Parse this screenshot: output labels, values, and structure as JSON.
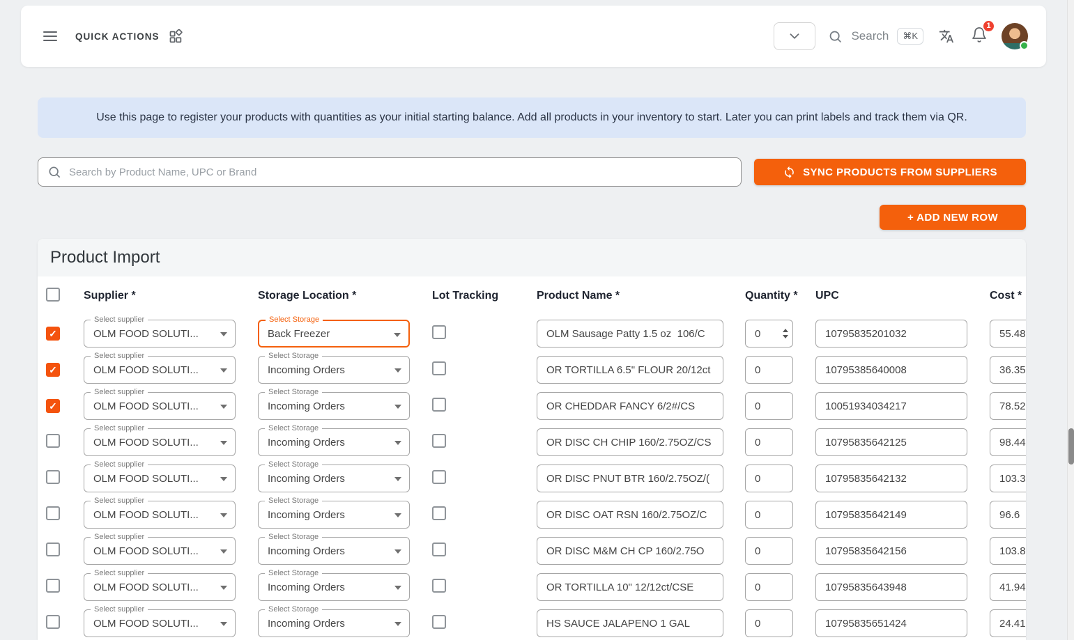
{
  "colors": {
    "accent": "#f4600c",
    "checkbox": "#f4530e",
    "banner_bg": "#dbe6f8",
    "badge_red": "#ef4130",
    "status_green": "#36b24a"
  },
  "topbar": {
    "quick_actions": "QUICK ACTIONS",
    "search_label": "Search",
    "search_shortcut": "⌘K",
    "notification_badge": "1"
  },
  "banner_text": "Use this page to register your products with quantities as your initial starting balance. Add all products in your inventory to start. Later you can print labels and track them via QR.",
  "search_placeholder": "Search by Product Name, UPC or Brand",
  "sync_button": "SYNC PRODUCTS FROM SUPPLIERS",
  "add_row_button": "+ ADD NEW ROW",
  "section_title": "Product Import",
  "table": {
    "headers": {
      "supplier": "Supplier *",
      "storage": "Storage Location *",
      "lot": "Lot Tracking",
      "product": "Product Name *",
      "quantity": "Quantity *",
      "upc": "UPC",
      "cost": "Cost *"
    },
    "supplier_label": "Select supplier",
    "storage_label": "Select Storage",
    "rows": [
      {
        "checked": true,
        "supplier": "OLM FOOD SOLUTI...",
        "storage": "Back Freezer",
        "storage_focused": true,
        "lot": false,
        "product": "OLM Sausage Patty 1.5 oz  106/C",
        "quantity": "0",
        "stepper": true,
        "upc": "10795835201032",
        "cost": "55.48"
      },
      {
        "checked": true,
        "supplier": "OLM FOOD SOLUTI...",
        "storage": "Incoming Orders",
        "storage_focused": false,
        "lot": false,
        "product": "OR TORTILLA 6.5\" FLOUR 20/12ct",
        "quantity": "0",
        "stepper": false,
        "upc": "10795385640008",
        "cost": "36.35"
      },
      {
        "checked": true,
        "supplier": "OLM FOOD SOLUTI...",
        "storage": "Incoming Orders",
        "storage_focused": false,
        "lot": false,
        "product": "OR CHEDDAR FANCY 6/2#/CS",
        "quantity": "0",
        "stepper": false,
        "upc": "10051934034217",
        "cost": "78.52"
      },
      {
        "checked": false,
        "supplier": "OLM FOOD SOLUTI...",
        "storage": "Incoming Orders",
        "storage_focused": false,
        "lot": false,
        "product": "OR DISC CH CHIP 160/2.75OZ/CS",
        "quantity": "0",
        "stepper": false,
        "upc": "10795835642125",
        "cost": "98.44"
      },
      {
        "checked": false,
        "supplier": "OLM FOOD SOLUTI...",
        "storage": "Incoming Orders",
        "storage_focused": false,
        "lot": false,
        "product": "OR DISC PNUT BTR 160/2.75OZ/(",
        "quantity": "0",
        "stepper": false,
        "upc": "10795835642132",
        "cost": "103.3"
      },
      {
        "checked": false,
        "supplier": "OLM FOOD SOLUTI...",
        "storage": "Incoming Orders",
        "storage_focused": false,
        "lot": false,
        "product": "OR DISC OAT RSN 160/2.75OZ/C",
        "quantity": "0",
        "stepper": false,
        "upc": "10795835642149",
        "cost": "96.6"
      },
      {
        "checked": false,
        "supplier": "OLM FOOD SOLUTI...",
        "storage": "Incoming Orders",
        "storage_focused": false,
        "lot": false,
        "product": "OR DISC M&M CH CP 160/2.75O",
        "quantity": "0",
        "stepper": false,
        "upc": "10795835642156",
        "cost": "103.8"
      },
      {
        "checked": false,
        "supplier": "OLM FOOD SOLUTI...",
        "storage": "Incoming Orders",
        "storage_focused": false,
        "lot": false,
        "product": "OR TORTILLA 10\" 12/12ct/CSE",
        "quantity": "0",
        "stepper": false,
        "upc": "10795835643948",
        "cost": "41.94"
      },
      {
        "checked": false,
        "supplier": "OLM FOOD SOLUTI...",
        "storage": "Incoming Orders",
        "storage_focused": false,
        "lot": false,
        "product": "HS SAUCE JALAPENO 1 GAL",
        "quantity": "0",
        "stepper": false,
        "upc": "10795835651424",
        "cost": "24.41"
      }
    ]
  }
}
